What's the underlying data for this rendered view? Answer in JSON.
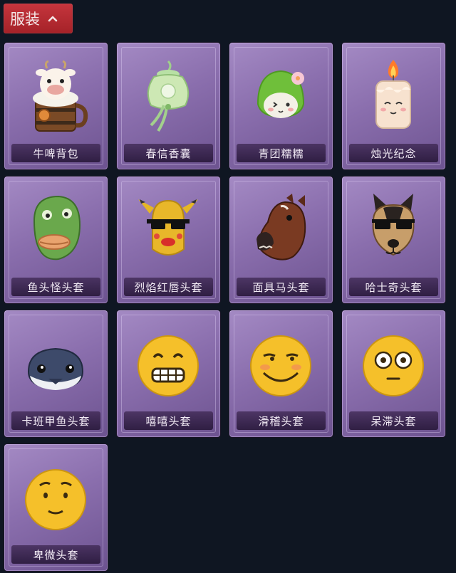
{
  "section": {
    "title": "服装",
    "toggle_icon": "chevron-up-icon"
  },
  "colors": {
    "background": "#0f1622",
    "header": "#b52a31",
    "card": "#8a6ead"
  },
  "items": [
    {
      "label": "牛啤背包",
      "icon": "cow-beer-backpack-icon"
    },
    {
      "label": "春信香囊",
      "icon": "sachet-icon"
    },
    {
      "label": "青团糯糯",
      "icon": "green-dumpling-icon"
    },
    {
      "label": "烛光纪念",
      "icon": "candle-icon"
    },
    {
      "label": "鱼头怪头套",
      "icon": "fish-head-mask-icon"
    },
    {
      "label": "烈焰红唇头套",
      "icon": "red-lips-mask-icon"
    },
    {
      "label": "面具马头套",
      "icon": "horse-mask-icon"
    },
    {
      "label": "哈士奇头套",
      "icon": "husky-mask-icon"
    },
    {
      "label": "卡班甲鱼头套",
      "icon": "turtle-mask-icon"
    },
    {
      "label": "嘻嘻头套",
      "icon": "grin-emoji-mask-icon"
    },
    {
      "label": "滑稽头套",
      "icon": "silly-emoji-mask-icon"
    },
    {
      "label": "呆滞头套",
      "icon": "stunned-emoji-mask-icon"
    },
    {
      "label": "卑微头套",
      "icon": "humble-emoji-mask-icon"
    }
  ]
}
